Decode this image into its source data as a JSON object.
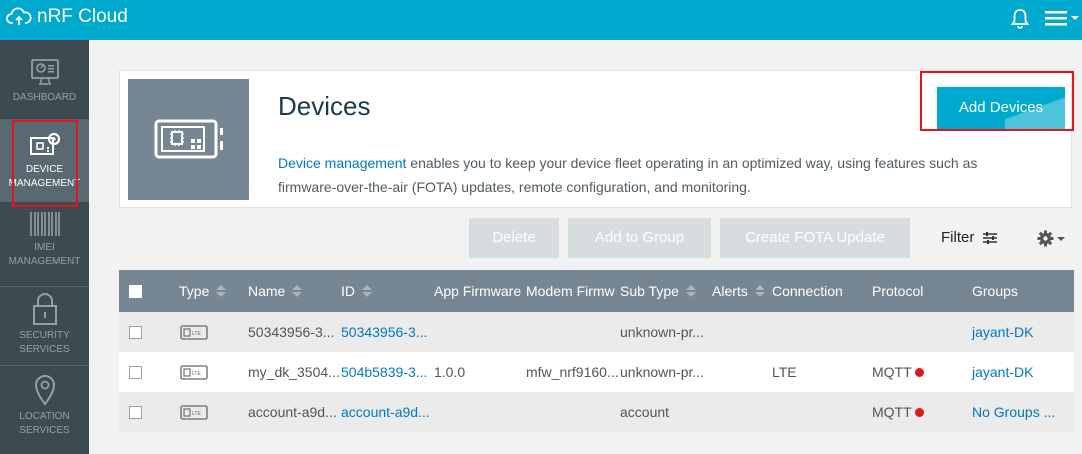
{
  "app": {
    "title": "nRF Cloud"
  },
  "topbar": {
    "icons": [
      "cloud-upload-icon",
      "bell-icon",
      "hamburger-menu-icon",
      "chevron-down-icon"
    ]
  },
  "sidebar": {
    "items": [
      {
        "label": "DASHBOARD",
        "icon": "dashboard-icon"
      },
      {
        "label": "DEVICE MANAGEMENT",
        "icon": "device-management-icon",
        "active": true
      },
      {
        "label": "IMEI MANAGEMENT",
        "icon": "barcode-icon"
      },
      {
        "label": "SECURITY SERVICES",
        "icon": "lock-icon"
      },
      {
        "label": "LOCATION SERVICES",
        "icon": "location-pin-icon"
      }
    ]
  },
  "header": {
    "title": "Devices",
    "link_text": "Device management",
    "description": " enables you to keep your device fleet operating in an optimized way, using features such as firmware-over-the-air (FOTA) updates, remote configuration, and monitoring.",
    "add_button": "Add Devices"
  },
  "toolbar": {
    "delete": "Delete",
    "add_to_group": "Add to Group",
    "create_fota": "Create FOTA Update",
    "filter": "Filter"
  },
  "table": {
    "columns": {
      "type": "Type",
      "name": "Name",
      "id": "ID",
      "app_firmware": "App Firmware",
      "modem_firmware": "Modem Firmw",
      "sub_type": "Sub Type",
      "alerts": "Alerts",
      "connection": "Connection",
      "protocol": "Protocol",
      "groups": "Groups"
    },
    "rows": [
      {
        "type_icon": "lte-device-icon",
        "name": "50343956-3...",
        "id": "50343956-3...",
        "app_firmware": "",
        "modem_firmware": "",
        "sub_type": "unknown-pr...",
        "alerts": "",
        "connection": "",
        "protocol": "",
        "protocol_status": "",
        "groups": "jayant-DK"
      },
      {
        "type_icon": "lte-device-icon",
        "name": "my_dk_3504...",
        "id": "504b5839-3...",
        "app_firmware": "1.0.0",
        "modem_firmware": "mfw_nrf9160...",
        "sub_type": "unknown-pr...",
        "alerts": "",
        "connection": "LTE",
        "protocol": "MQTT",
        "protocol_status": "#e0161c",
        "groups": "jayant-DK"
      },
      {
        "type_icon": "lte-device-icon",
        "name": "account-a9d...",
        "id": "account-a9d...",
        "app_firmware": "",
        "modem_firmware": "",
        "sub_type": "account",
        "alerts": "",
        "connection": "",
        "protocol": "MQTT",
        "protocol_status": "#e0161c",
        "groups": "No Groups ..."
      }
    ]
  },
  "colors": {
    "topbar": "#00a9ce",
    "sidebar": "#3d4a52",
    "table_header": "#768692",
    "link": "#0077c8",
    "highlight": "#e0161c"
  }
}
